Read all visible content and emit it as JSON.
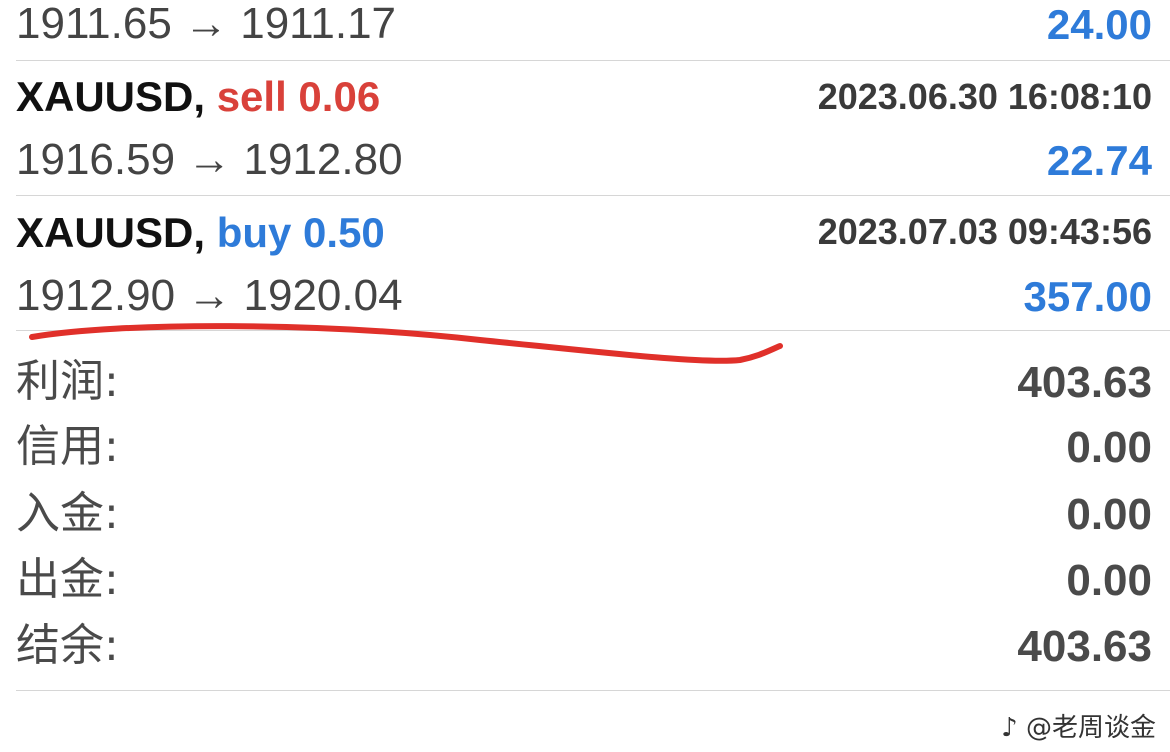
{
  "trades": [
    {
      "prices": "1911.65 → 1911.17",
      "profit": "24.00"
    },
    {
      "symbol": "XAUUSD,",
      "type": "sell 0.06",
      "time": "2023.06.30 16:08:10",
      "prices": "1916.59 → 1912.80",
      "profit": "22.74"
    },
    {
      "symbol": "XAUUSD,",
      "type": "buy 0.50",
      "time": "2023.07.03 09:43:56",
      "prices": "1912.90 → 1920.04",
      "profit": "357.00"
    }
  ],
  "summary": [
    {
      "label": "利润:",
      "value": "403.63"
    },
    {
      "label": "信用:",
      "value": "0.00"
    },
    {
      "label": "入金:",
      "value": "0.00"
    },
    {
      "label": "出金:",
      "value": "0.00"
    },
    {
      "label": "结余:",
      "value": "403.63"
    }
  ],
  "watermark": "@老周谈金",
  "colors": {
    "sell": "#d9413a",
    "buy": "#2e7bd9",
    "annotation": "#e0302a"
  }
}
